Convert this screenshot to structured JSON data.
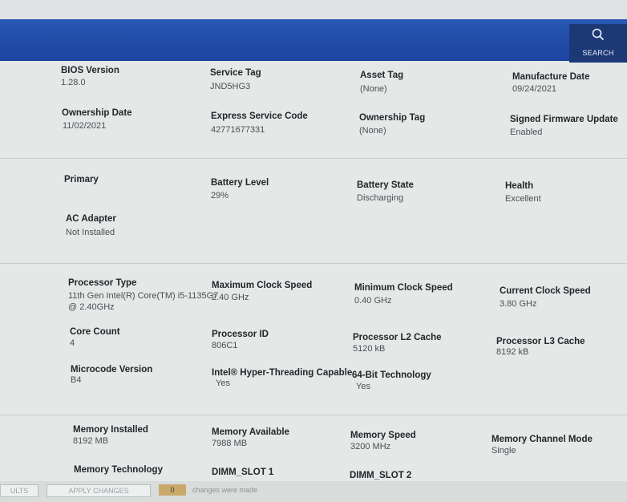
{
  "header": {
    "search_label": "SEARCH"
  },
  "system": {
    "bios_version_label": "BIOS Version",
    "bios_version": "1.28.0",
    "service_tag_label": "Service Tag",
    "service_tag": "JND5HG3",
    "asset_tag_label": "Asset Tag",
    "asset_tag": "(None)",
    "manufacture_date_label": "Manufacture Date",
    "manufacture_date": "09/24/2021",
    "ownership_date_label": "Ownership Date",
    "ownership_date": "11/02/2021",
    "express_code_label": "Express Service Code",
    "express_code": "42771677331",
    "ownership_tag_label": "Ownership Tag",
    "ownership_tag": "(None)",
    "signed_fw_label": "Signed Firmware Update",
    "signed_fw": "Enabled"
  },
  "battery": {
    "primary_label": "Primary",
    "level_label": "Battery Level",
    "level": "29%",
    "state_label": "Battery State",
    "state": "Discharging",
    "health_label": "Health",
    "health": "Excellent",
    "ac_label": "AC Adapter",
    "ac": "Not Installed"
  },
  "processor": {
    "type_label": "Processor Type",
    "type_line1": "11th Gen Intel(R) Core(TM) i5-1135G7",
    "type_line2": "@ 2.40GHz",
    "max_clock_label": "Maximum Clock Speed",
    "max_clock": "2.40 GHz",
    "min_clock_label": "Minimum Clock Speed",
    "min_clock": "0.40 GHz",
    "cur_clock_label": "Current Clock Speed",
    "cur_clock": "3.80 GHz",
    "core_count_label": "Core Count",
    "core_count": "4",
    "id_label": "Processor ID",
    "id": "806C1",
    "l2_label": "Processor L2 Cache",
    "l2": "5120 kB",
    "l3_label": "Processor L3 Cache",
    "l3": "8192 kB",
    "microcode_label": "Microcode Version",
    "microcode": "B4",
    "ht_label": "Intel® Hyper-Threading Capable",
    "ht": "Yes",
    "x64_label": "64-Bit Technology",
    "x64": "Yes"
  },
  "memory": {
    "installed_label": "Memory Installed",
    "installed": "8192 MB",
    "available_label": "Memory Available",
    "available": "7988 MB",
    "speed_label": "Memory Speed",
    "speed": "3200 MHz",
    "channel_label": "Memory Channel Mode",
    "channel": "Single",
    "technology_label": "Memory Technology",
    "dimm1_label": "DIMM_SLOT 1",
    "dimm2_label": "DIMM_SLOT 2"
  },
  "footer": {
    "left_btn": "ULTS",
    "apply_btn": "APPLY CHANGES",
    "count": "0",
    "message": "changes were made"
  }
}
